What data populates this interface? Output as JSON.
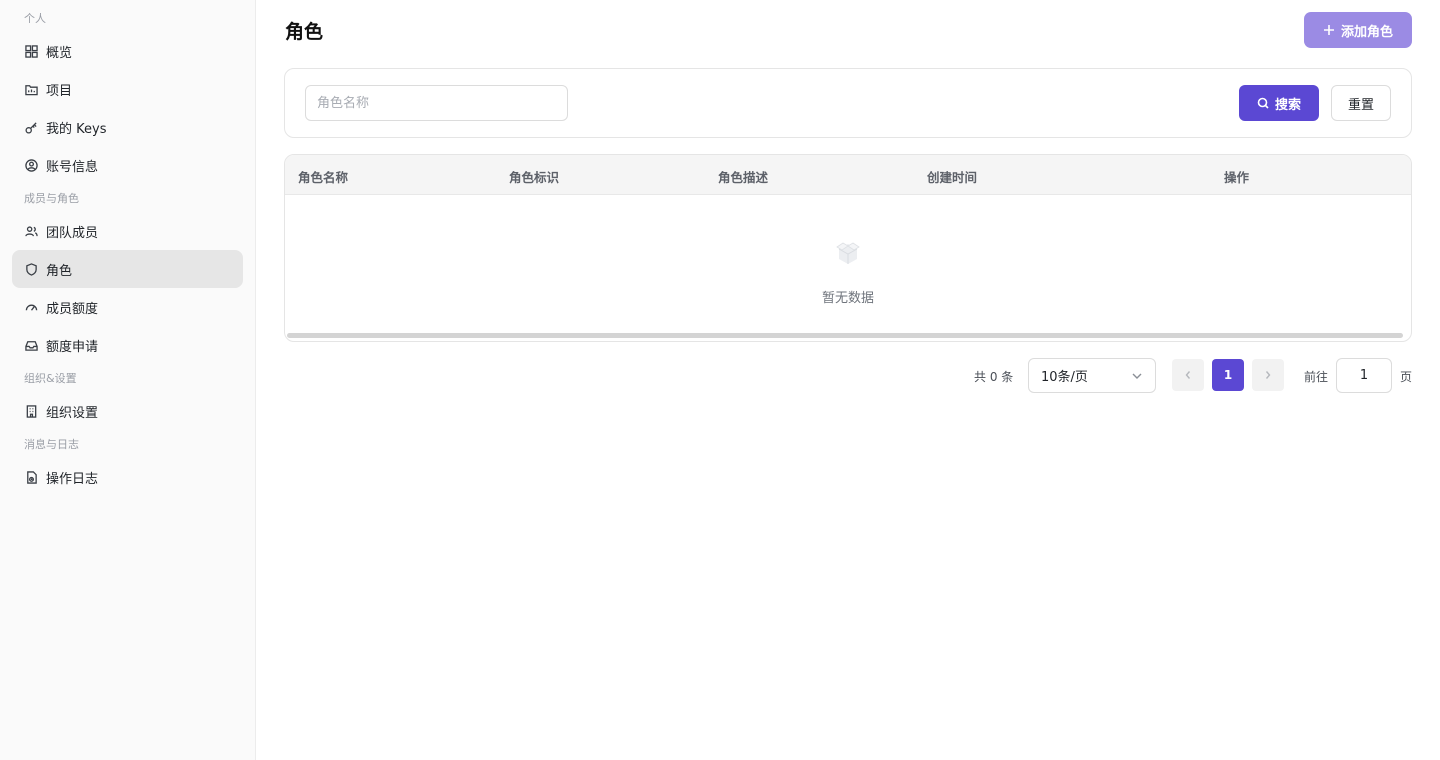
{
  "sidebar": {
    "sections": [
      {
        "title": "个人"
      },
      {
        "title": "成员与角色"
      },
      {
        "title": "组织&设置"
      },
      {
        "title": "消息与日志"
      }
    ],
    "items": [
      {
        "label": "概览",
        "icon": "grid-icon"
      },
      {
        "label": "项目",
        "icon": "folder-icon"
      },
      {
        "label": "我的 Keys",
        "icon": "key-icon"
      },
      {
        "label": "账号信息",
        "icon": "user-circle-icon"
      },
      {
        "label": "团队成员",
        "icon": "users-icon"
      },
      {
        "label": "角色",
        "icon": "shield-icon",
        "active": true
      },
      {
        "label": "成员额度",
        "icon": "gauge-icon"
      },
      {
        "label": "额度申请",
        "icon": "inbox-icon"
      },
      {
        "label": "组织设置",
        "icon": "building-icon"
      },
      {
        "label": "操作日志",
        "icon": "file-log-icon"
      }
    ]
  },
  "header": {
    "title": "角色",
    "add_button_label": "添加角色"
  },
  "filter": {
    "placeholder": "角色名称",
    "value": "",
    "search_label": "搜索",
    "reset_label": "重置"
  },
  "table": {
    "columns": [
      "角色名称",
      "角色标识",
      "角色描述",
      "创建时间",
      "操作"
    ],
    "rows": [],
    "empty_text": "暂无数据"
  },
  "pagination": {
    "total_text": "共 0 条",
    "page_size": "10条/页",
    "current_page": "1",
    "goto_label": "前往",
    "goto_value": "1",
    "goto_suffix": "页"
  },
  "colors": {
    "accent": "#5b48d3",
    "accent_light": "#9b8be4",
    "sidebar_bg": "#fafafa",
    "active_bg": "#e6e6e6"
  }
}
